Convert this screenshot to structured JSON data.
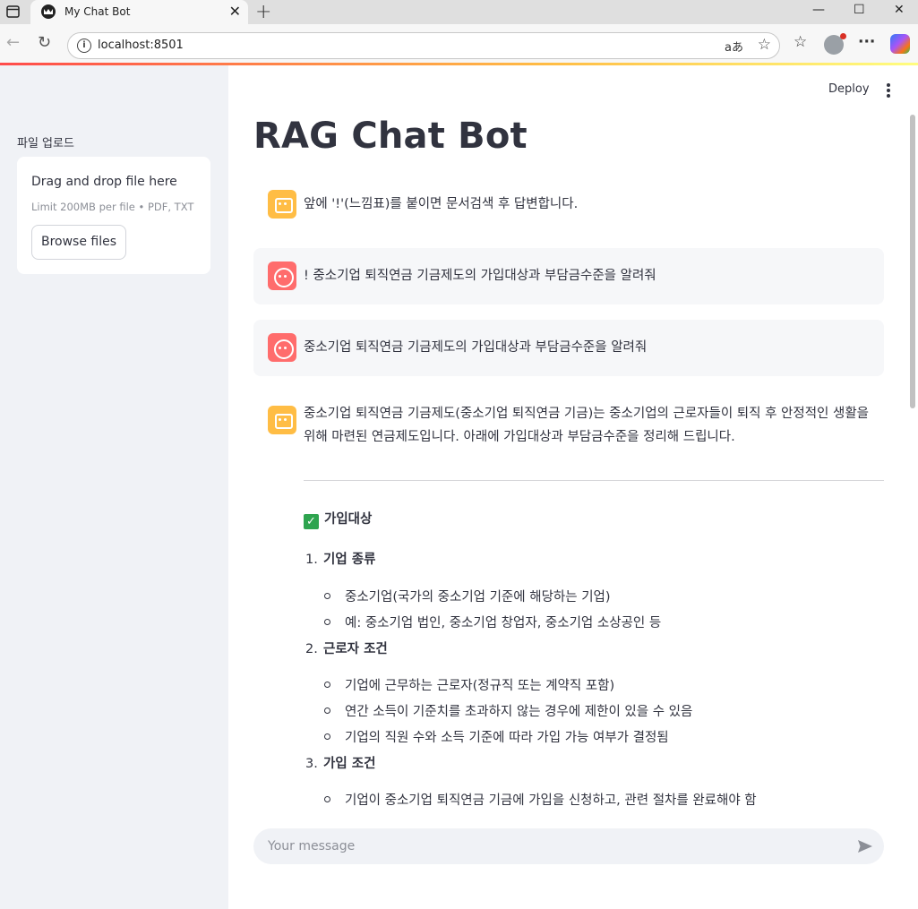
{
  "browser": {
    "tab_title": "My Chat Bot",
    "url": "localhost:8501",
    "read_aloud": "aあ"
  },
  "sidebar": {
    "label": "파일 업로드",
    "dropzone_title": "Drag and drop file here",
    "dropzone_limits": "Limit 200MB per file • PDF, TXT",
    "browse_label": "Browse files"
  },
  "header": {
    "deploy_label": "Deploy"
  },
  "main": {
    "title": "RAG Chat Bot",
    "messages": [
      {
        "role": "assistant",
        "text": "앞에 '!'(느낌표)를 붙이면 문서검색 후 답변합니다."
      },
      {
        "role": "user",
        "text": "! 중소기업 퇴직연금 기금제도의 가입대상과 부담금수준을 알려줘"
      },
      {
        "role": "user",
        "text": "중소기업 퇴직연금 기금제도의 가입대상과 부담금수준을 알려줘"
      },
      {
        "role": "assistant",
        "text": "중소기업 퇴직연금 기금제도(중소기업 퇴직연금 기금)는 중소기업의 근로자들이 퇴직 후 안정적인 생활을 위해 마련된 연금제도입니다. 아래에 가입대상과 부담금수준을 정리해 드립니다."
      }
    ],
    "answer_section": {
      "heading": "가입대상",
      "items": [
        {
          "num": "1.",
          "title": "기업 종류",
          "bullets": [
            "중소기업(국가의 중소기업 기준에 해당하는 기업)",
            "예: 중소기업 법인, 중소기업 창업자, 중소기업 소상공인 등"
          ]
        },
        {
          "num": "2.",
          "title": "근로자 조건",
          "bullets": [
            "기업에 근무하는 근로자(정규직 또는 계약직 포함)",
            "연간 소득이 기준치를 초과하지 않는 경우에 제한이 있을 수 있음",
            "기업의 직원 수와 소득 기준에 따라 가입 가능 여부가 결정됨"
          ]
        },
        {
          "num": "3.",
          "title": "가입 조건",
          "bullets": [
            "기업이 중소기업 퇴직연금 기금에 가입을 신청하고, 관련 절차를 완료해야 함"
          ]
        }
      ]
    },
    "chat_input": {
      "placeholder": "Your message",
      "value": ""
    }
  }
}
